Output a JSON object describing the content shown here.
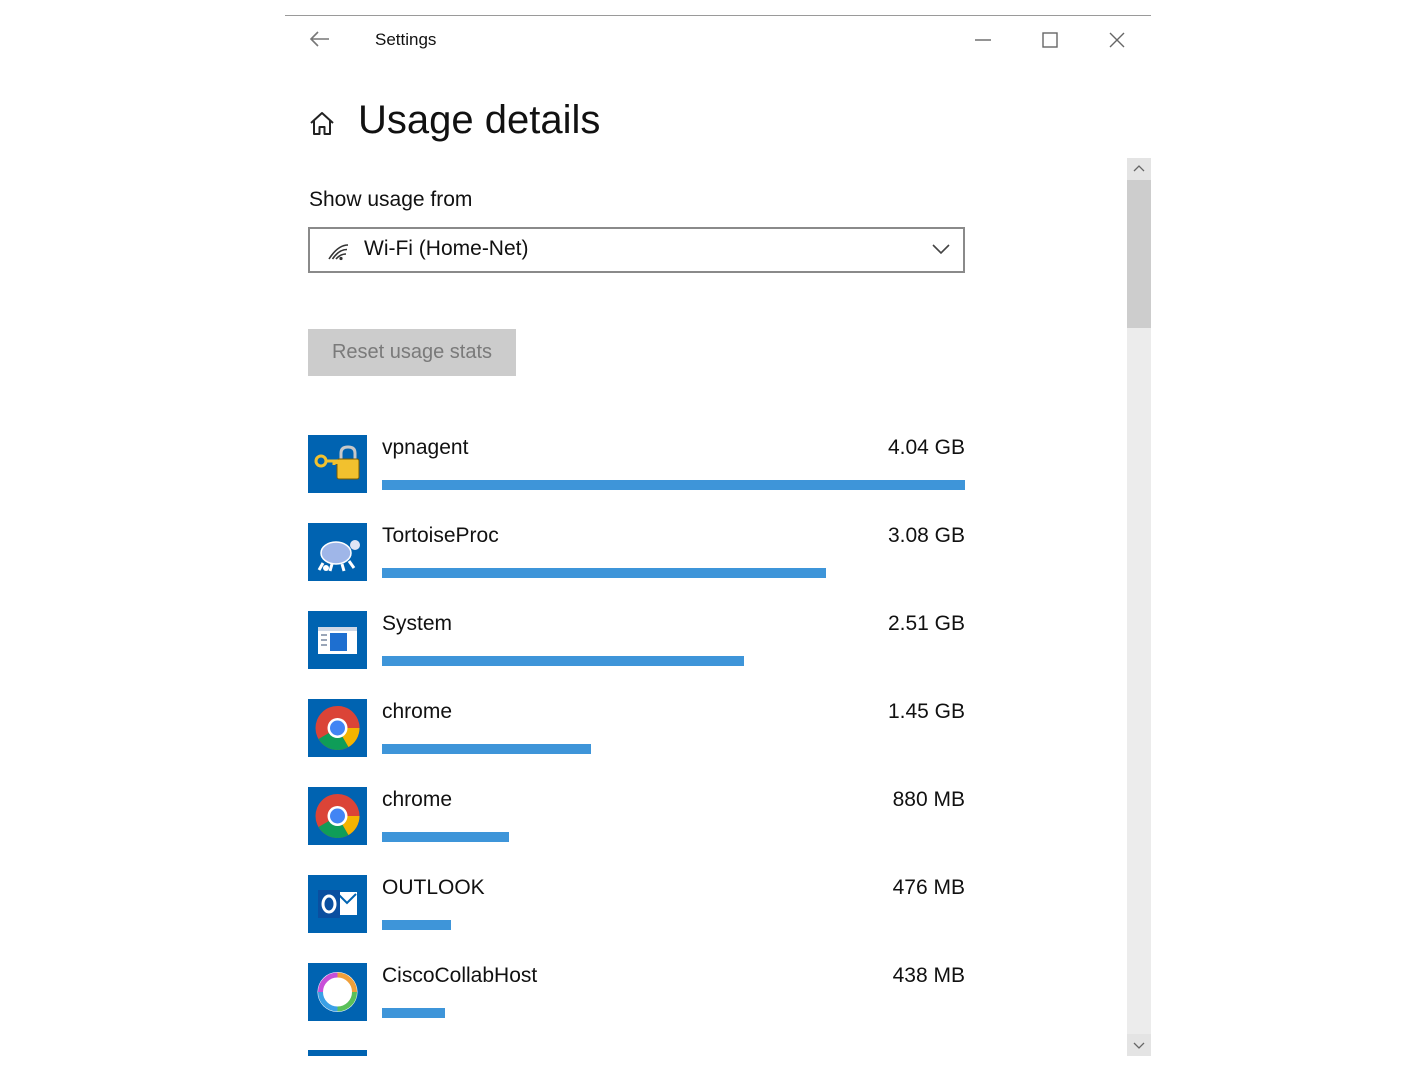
{
  "window": {
    "title": "Settings"
  },
  "header": {
    "title": "Usage details"
  },
  "usage_filter": {
    "label": "Show usage from",
    "selected": "Wi-Fi (Home-Net)"
  },
  "reset_button": {
    "label": "Reset usage stats"
  },
  "apps": [
    {
      "name": "vpnagent",
      "usage": "4.04 GB",
      "usage_gb": 4.04,
      "icon": "vpnagent-lock-key-icon"
    },
    {
      "name": "TortoiseProc",
      "usage": "3.08 GB",
      "usage_gb": 3.08,
      "icon": "tortoise-icon"
    },
    {
      "name": "System",
      "usage": "2.51 GB",
      "usage_gb": 2.51,
      "icon": "system-window-icon"
    },
    {
      "name": "chrome",
      "usage": "1.45 GB",
      "usage_gb": 1.45,
      "icon": "chrome-icon"
    },
    {
      "name": "chrome",
      "usage": "880 MB",
      "usage_gb": 0.88,
      "icon": "chrome-icon"
    },
    {
      "name": "OUTLOOK",
      "usage": "476 MB",
      "usage_gb": 0.476,
      "icon": "outlook-icon"
    },
    {
      "name": "CiscoCollabHost",
      "usage": "438 MB",
      "usage_gb": 0.438,
      "icon": "cisco-collab-icon"
    }
  ],
  "colors": {
    "accent": "#0063b1",
    "bar": "#3e95d9",
    "button_disabled_bg": "#cccccc",
    "button_disabled_text": "#7a7a7a"
  }
}
